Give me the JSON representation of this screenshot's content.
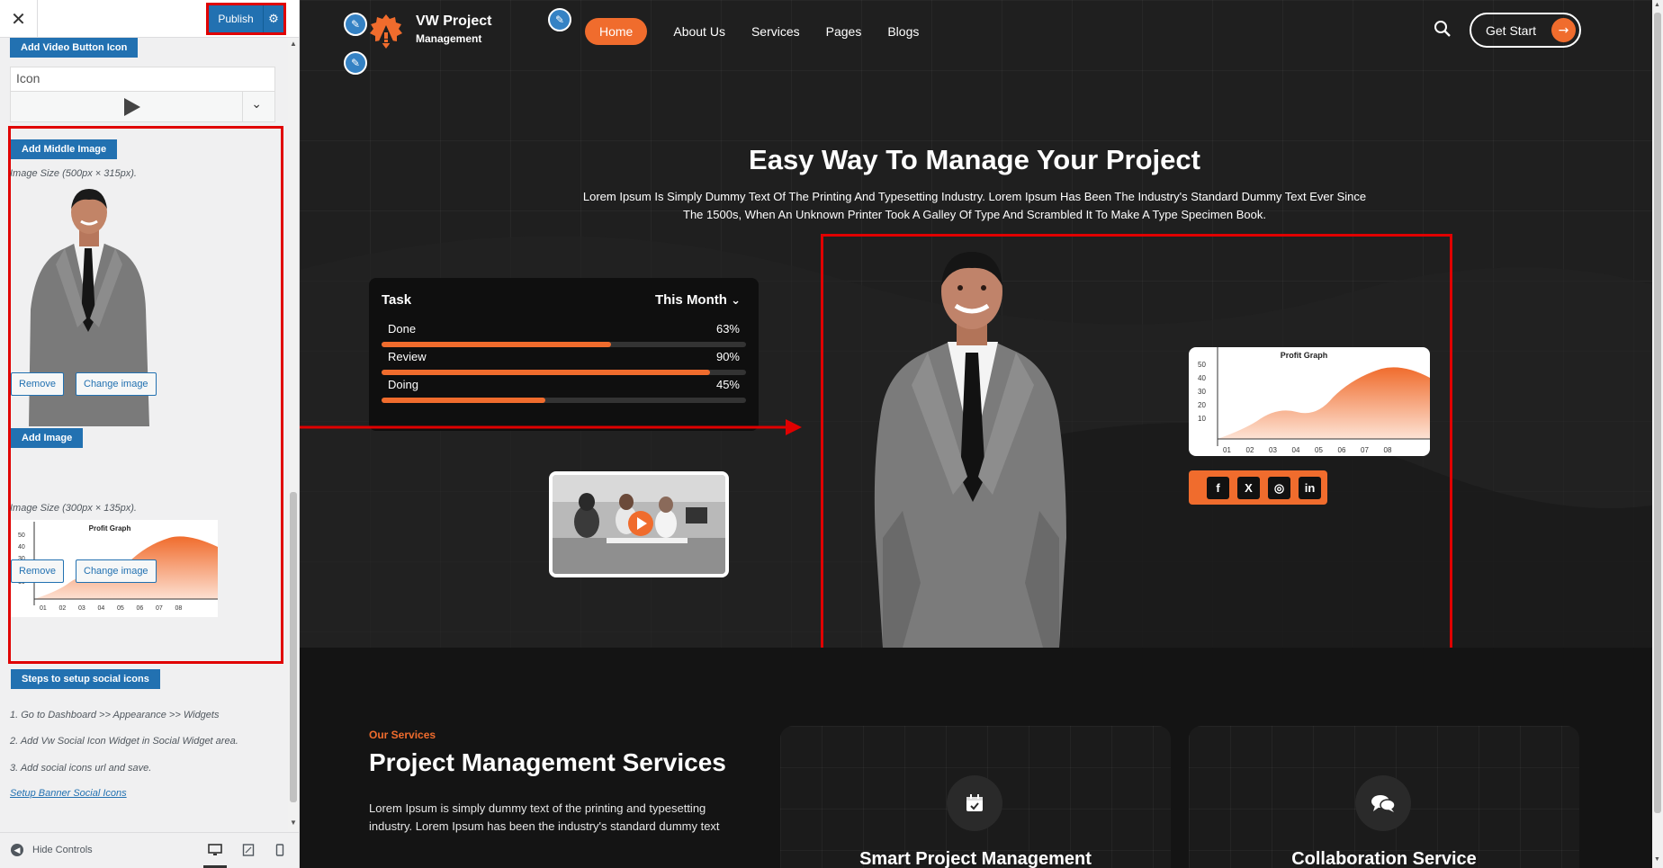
{
  "customizer": {
    "close_icon": "close-icon",
    "publish_label": "Publish",
    "settings_icon": "gear-icon",
    "add_video_button_icon_label": "Add Video Button Icon",
    "icon_field_value": "Icon",
    "icon_select_value_icon": "play-icon",
    "add_middle_image_label": "Add Middle Image",
    "middle_image_size_note": "Image Size (500px × 315px).",
    "remove_label": "Remove",
    "change_image_label": "Change image",
    "add_image_label": "Add Image",
    "image_size_note": "Image Size (300px × 135px).",
    "remove_label_2": "Remove",
    "change_image_label_2": "Change image",
    "social_steps_label": "Steps to setup social icons",
    "steps": [
      "1. Go to Dashboard >> Appearance >> Widgets",
      "2. Add Vw Social Icon Widget in Social Widget area.",
      "3. Add social icons url and save."
    ],
    "setup_link_label": "Setup Banner Social Icons",
    "hide_controls_label": "Hide Controls",
    "devices": [
      "desktop-icon",
      "tablet-icon",
      "mobile-icon"
    ]
  },
  "site": {
    "logo_line1": "VW Project",
    "logo_line2": "Management",
    "nav": [
      {
        "label": "Home",
        "active": true
      },
      {
        "label": "About Us",
        "active": false
      },
      {
        "label": "Services",
        "active": false
      },
      {
        "label": "Pages",
        "active": false
      },
      {
        "label": "Blogs",
        "active": false
      }
    ],
    "cta_label": "Get Start",
    "accent_color": "#f06c2d",
    "hero": {
      "title": "Easy Way To Manage Your Project",
      "desc_line1": "Lorem Ipsum Is Simply Dummy Text Of The Printing And Typesetting Industry. Lorem Ipsum Has Been The Industry's Standard Dummy Text Ever Since",
      "desc_line2": "The 1500s, When An Unknown Printer Took A Galley Of Type And Scrambled It To Make A Type Specimen Book."
    },
    "task_card": {
      "title": "Task",
      "period": "This Month",
      "rows": [
        {
          "label": "Done",
          "percent": "63%",
          "value": 0.63
        },
        {
          "label": "Review",
          "percent": "90%",
          "value": 0.9
        },
        {
          "label": "Doing",
          "percent": "45%",
          "value": 0.45
        }
      ]
    },
    "profit_graph": {
      "title": "Profit Graph",
      "y_ticks": [
        "50",
        "40",
        "30",
        "20",
        "10"
      ],
      "x_ticks": [
        "01",
        "02",
        "03",
        "04",
        "05",
        "06",
        "07",
        "08"
      ]
    },
    "social": [
      "f",
      "X",
      "◎",
      "in"
    ],
    "services": {
      "kicker": "Our Services",
      "title": "Project Management Services",
      "desc_line1": "Lorem Ipsum is simply dummy text of the printing and typesetting",
      "desc_line2": "industry. Lorem Ipsum has been the industry's standard dummy text",
      "cards": [
        {
          "title": "Smart Project Management",
          "icon": "calendar-icon"
        },
        {
          "title": "Collaboration Service",
          "icon": "chat-icon"
        }
      ]
    }
  }
}
